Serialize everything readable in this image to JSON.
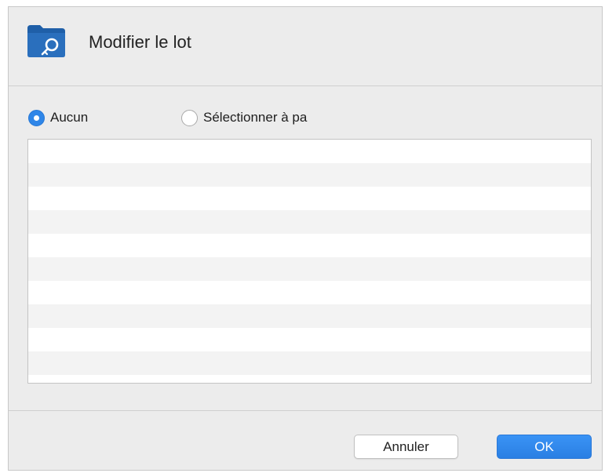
{
  "dialog": {
    "title": "Modifier le lot",
    "icon": "folder-key-icon"
  },
  "selection": {
    "options": [
      {
        "label": "Aucun",
        "selected": true
      },
      {
        "label": "Sélectionner à pa",
        "selected": false
      }
    ]
  },
  "list": {
    "rows": [
      "",
      "",
      "",
      "",
      "",
      "",
      "",
      "",
      "",
      "",
      ""
    ]
  },
  "buttons": {
    "cancel_label": "Annuler",
    "ok_label": "OK"
  },
  "colors": {
    "accent": "#2f86e8",
    "icon_blue": "#1f5fa8"
  }
}
